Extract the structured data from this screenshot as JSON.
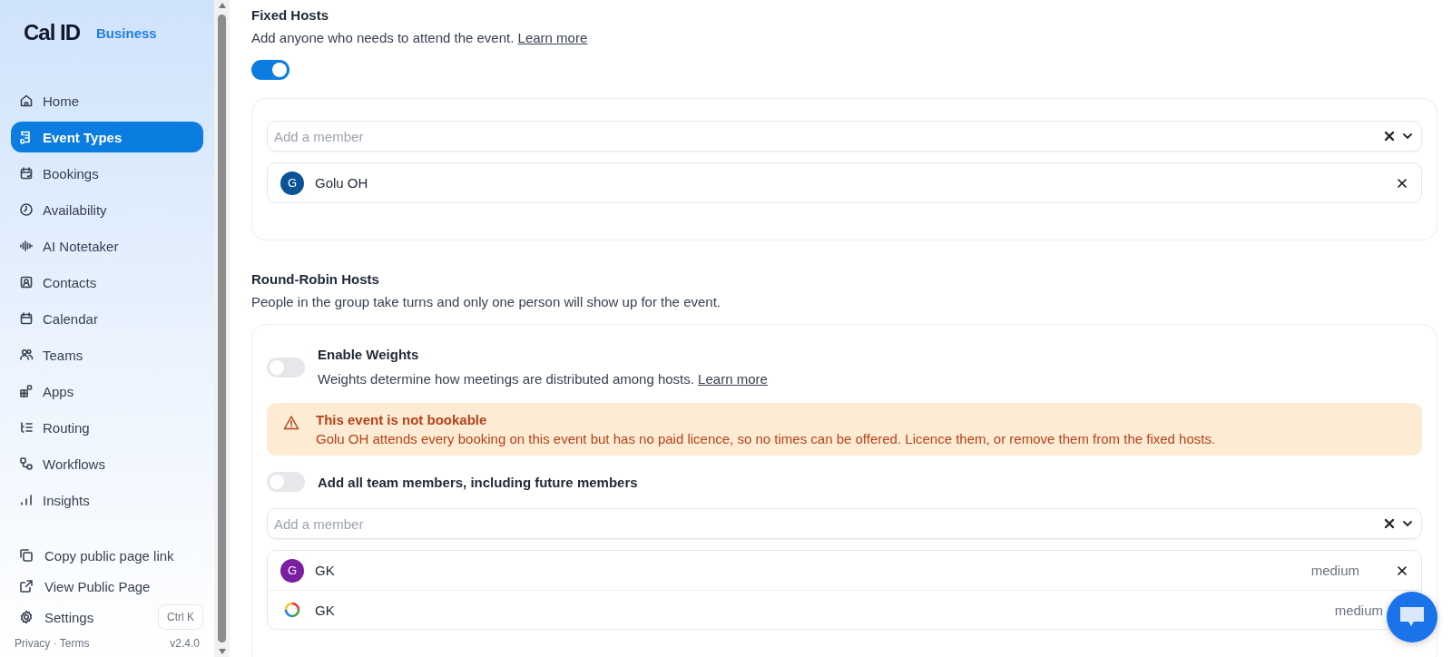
{
  "sidebar": {
    "logo": "Cal ID",
    "plan": "Business",
    "items": [
      {
        "label": "Home",
        "selected": false
      },
      {
        "label": "Event Types",
        "selected": true
      },
      {
        "label": "Bookings",
        "selected": false
      },
      {
        "label": "Availability",
        "selected": false
      },
      {
        "label": "AI Notetaker",
        "selected": false
      },
      {
        "label": "Contacts",
        "selected": false
      },
      {
        "label": "Calendar",
        "selected": false
      },
      {
        "label": "Teams",
        "selected": false
      },
      {
        "label": "Apps",
        "selected": false
      },
      {
        "label": "Routing",
        "selected": false
      },
      {
        "label": "Workflows",
        "selected": false
      },
      {
        "label": "Insights",
        "selected": false
      }
    ],
    "bottom_items": [
      {
        "label": "Copy public page link"
      },
      {
        "label": "View Public Page"
      },
      {
        "label": "Settings",
        "shortcut": "Ctrl K"
      }
    ],
    "footer": {
      "links": "Privacy · Terms",
      "version": "v2.4.0"
    }
  },
  "fixed_hosts": {
    "title": "Fixed Hosts",
    "description": "Add anyone who needs to attend the event.",
    "link": "Learn more",
    "on": true,
    "search": {
      "placeholder": "Add a member"
    },
    "members": [
      {
        "name": "Golu OH",
        "kind": "letter",
        "initial": "G",
        "color": "#0b5394",
        "removable": true
      }
    ]
  },
  "round_robin": {
    "title": "Round-Robin Hosts",
    "description": "People in the group take turns and only one person will show up for the event.",
    "weights": {
      "label": "Enable Weights",
      "description": "Weights determine how meetings are distributed among hosts.",
      "link": "Learn more",
      "on": false
    },
    "alert": {
      "title": "This event is not bookable",
      "message": "Golu OH attends every booking on this event but has no paid licence, so no times can be offered. Licence them, or remove them from the fixed hosts."
    },
    "all_members": {
      "label": "Add all team members, including future members",
      "on": false
    },
    "search": {
      "placeholder": "Add a member"
    },
    "members": [
      {
        "name": "GK",
        "kind": "letter",
        "initial": "G",
        "color": "#7b1fa2",
        "priority": "medium",
        "removable": true
      },
      {
        "name": "GK",
        "kind": "ring",
        "priority": "medium"
      }
    ]
  }
}
